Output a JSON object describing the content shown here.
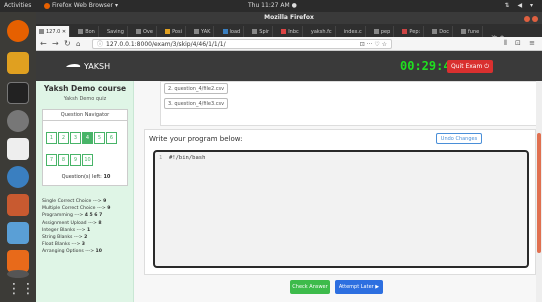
{
  "os": {
    "activities": "Activities",
    "app_name": "Firefox Web Browser ▾",
    "clock": "Thu 11:27 AM ●",
    "sys_icons": "⇅ ◀ ▾"
  },
  "browser": {
    "window_title": "Mozilla Firefox",
    "tabs": [
      "127.0 ✕",
      "Bon",
      "Saving",
      "Ove",
      "Posi",
      "YAK",
      "load",
      "Spir",
      "Inbc",
      "yaksh.fc",
      "index.c",
      "pep",
      "Pep:",
      "Doc",
      "fune",
      "≫ +"
    ],
    "url_host": "127.0.0.1",
    "url_path": ":8000/exam/3/skip/4/46/1/1/1/",
    "url_icons": "⊡ ··· ♡ ☆",
    "nav_right": "⫴ ⊡ ≡"
  },
  "header": {
    "logo_text": "YAKSH",
    "timer": "00:29:41",
    "quit_label": "Quit Exam ⏻"
  },
  "sidebar": {
    "course_name": "Yaksh Demo course",
    "quiz_name": "Yaksh Demo quiz",
    "navigator_title": "Question Navigator",
    "questions": [
      "1",
      "2",
      "3",
      "4",
      "5",
      "6",
      "7",
      "8",
      "9",
      "10"
    ],
    "current_question": "4",
    "questions_left_label": "Question(s) left:",
    "questions_left_value": "10",
    "types": [
      {
        "name": "Single Correct Choice --->",
        "value": "9"
      },
      {
        "name": "Multiple Correct Choice --->",
        "value": "9"
      },
      {
        "name": "Programming --->",
        "value": "4 5 6 7"
      },
      {
        "name": "Assignment Upload --->",
        "value": "8"
      },
      {
        "name": "Integer Blanks --->",
        "value": "1"
      },
      {
        "name": "String Blanks --->",
        "value": "2"
      },
      {
        "name": "Float Blanks --->",
        "value": "3"
      },
      {
        "name": "Arranging Options --->",
        "value": "10"
      }
    ]
  },
  "question": {
    "files": [
      "2. question_4/file2.csv",
      "3. question_4/file3.csv"
    ],
    "prompt": "Write your program below:",
    "undo_label": "Undo Changes",
    "line_number": "1",
    "code": "#!/bin/bash",
    "check_label": "Check Answer",
    "attempt_later_label": "Attempt Later ▶"
  },
  "colors": {
    "header_bg": "#3a3a3a",
    "timer": "#1fe01f",
    "quit": "#d9302f",
    "sidebar_bg": "#dff5e6",
    "nav_green": "#48b468",
    "check": "#3dbb4b",
    "attempt": "#2d6fe0"
  }
}
